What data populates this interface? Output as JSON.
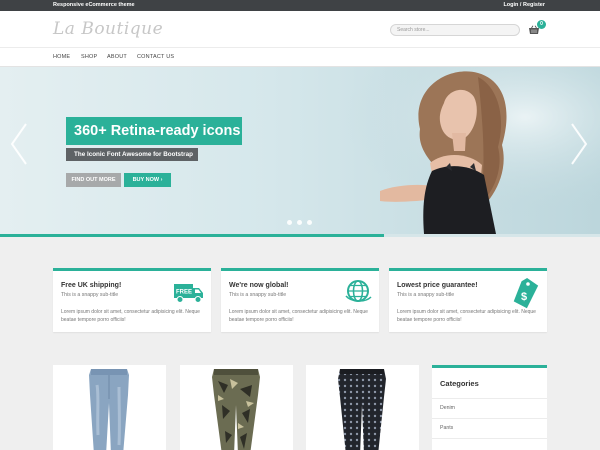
{
  "topbar": {
    "tagline": "Responsive eCommerce theme",
    "login": "Login / Register"
  },
  "header": {
    "logo": "La Boutique",
    "search_placeholder": "Search store...",
    "cart_count": "0"
  },
  "nav": {
    "items": [
      "HOME",
      "SHOP",
      "ABOUT",
      "CONTACT US"
    ]
  },
  "hero": {
    "title": "360+ Retina-ready icons",
    "subtitle": "The Iconic Font Awesome for Bootstrap",
    "find_out_more": "FIND OUT MORE",
    "buy_now": "BUY NOW",
    "slide_count": 3,
    "progress": 0.64
  },
  "features": [
    {
      "title": "Free UK shipping!",
      "subtitle": "This is a snappy sub-title",
      "text": "Lorem ipsum dolor sit amet, consectetur adipisicing elit. Neque beatae tempore porro officiis!",
      "icon": "truck-icon"
    },
    {
      "title": "We're now global!",
      "subtitle": "This is a snappy sub-title",
      "text": "Lorem ipsum dolor sit amet, consectetur adipisicing elit. Neque beatae tempore porro officiis!",
      "icon": "globe-icon"
    },
    {
      "title": "Lowest price guarantee!",
      "subtitle": "This is a snappy sub-title",
      "text": "Lorem ipsum dolor sit amet, consectetur adipisicing elit. Neque beatae tempore porro officiis!",
      "icon": "price-tag-icon"
    }
  ],
  "sidebar": {
    "title": "Categories",
    "items": [
      "Denim",
      "Pants"
    ]
  },
  "colors": {
    "accent": "#2bb199",
    "topbar": "#3f4245",
    "subtitle_bg": "#5e6265",
    "find_btn": "#a7a9aa"
  }
}
